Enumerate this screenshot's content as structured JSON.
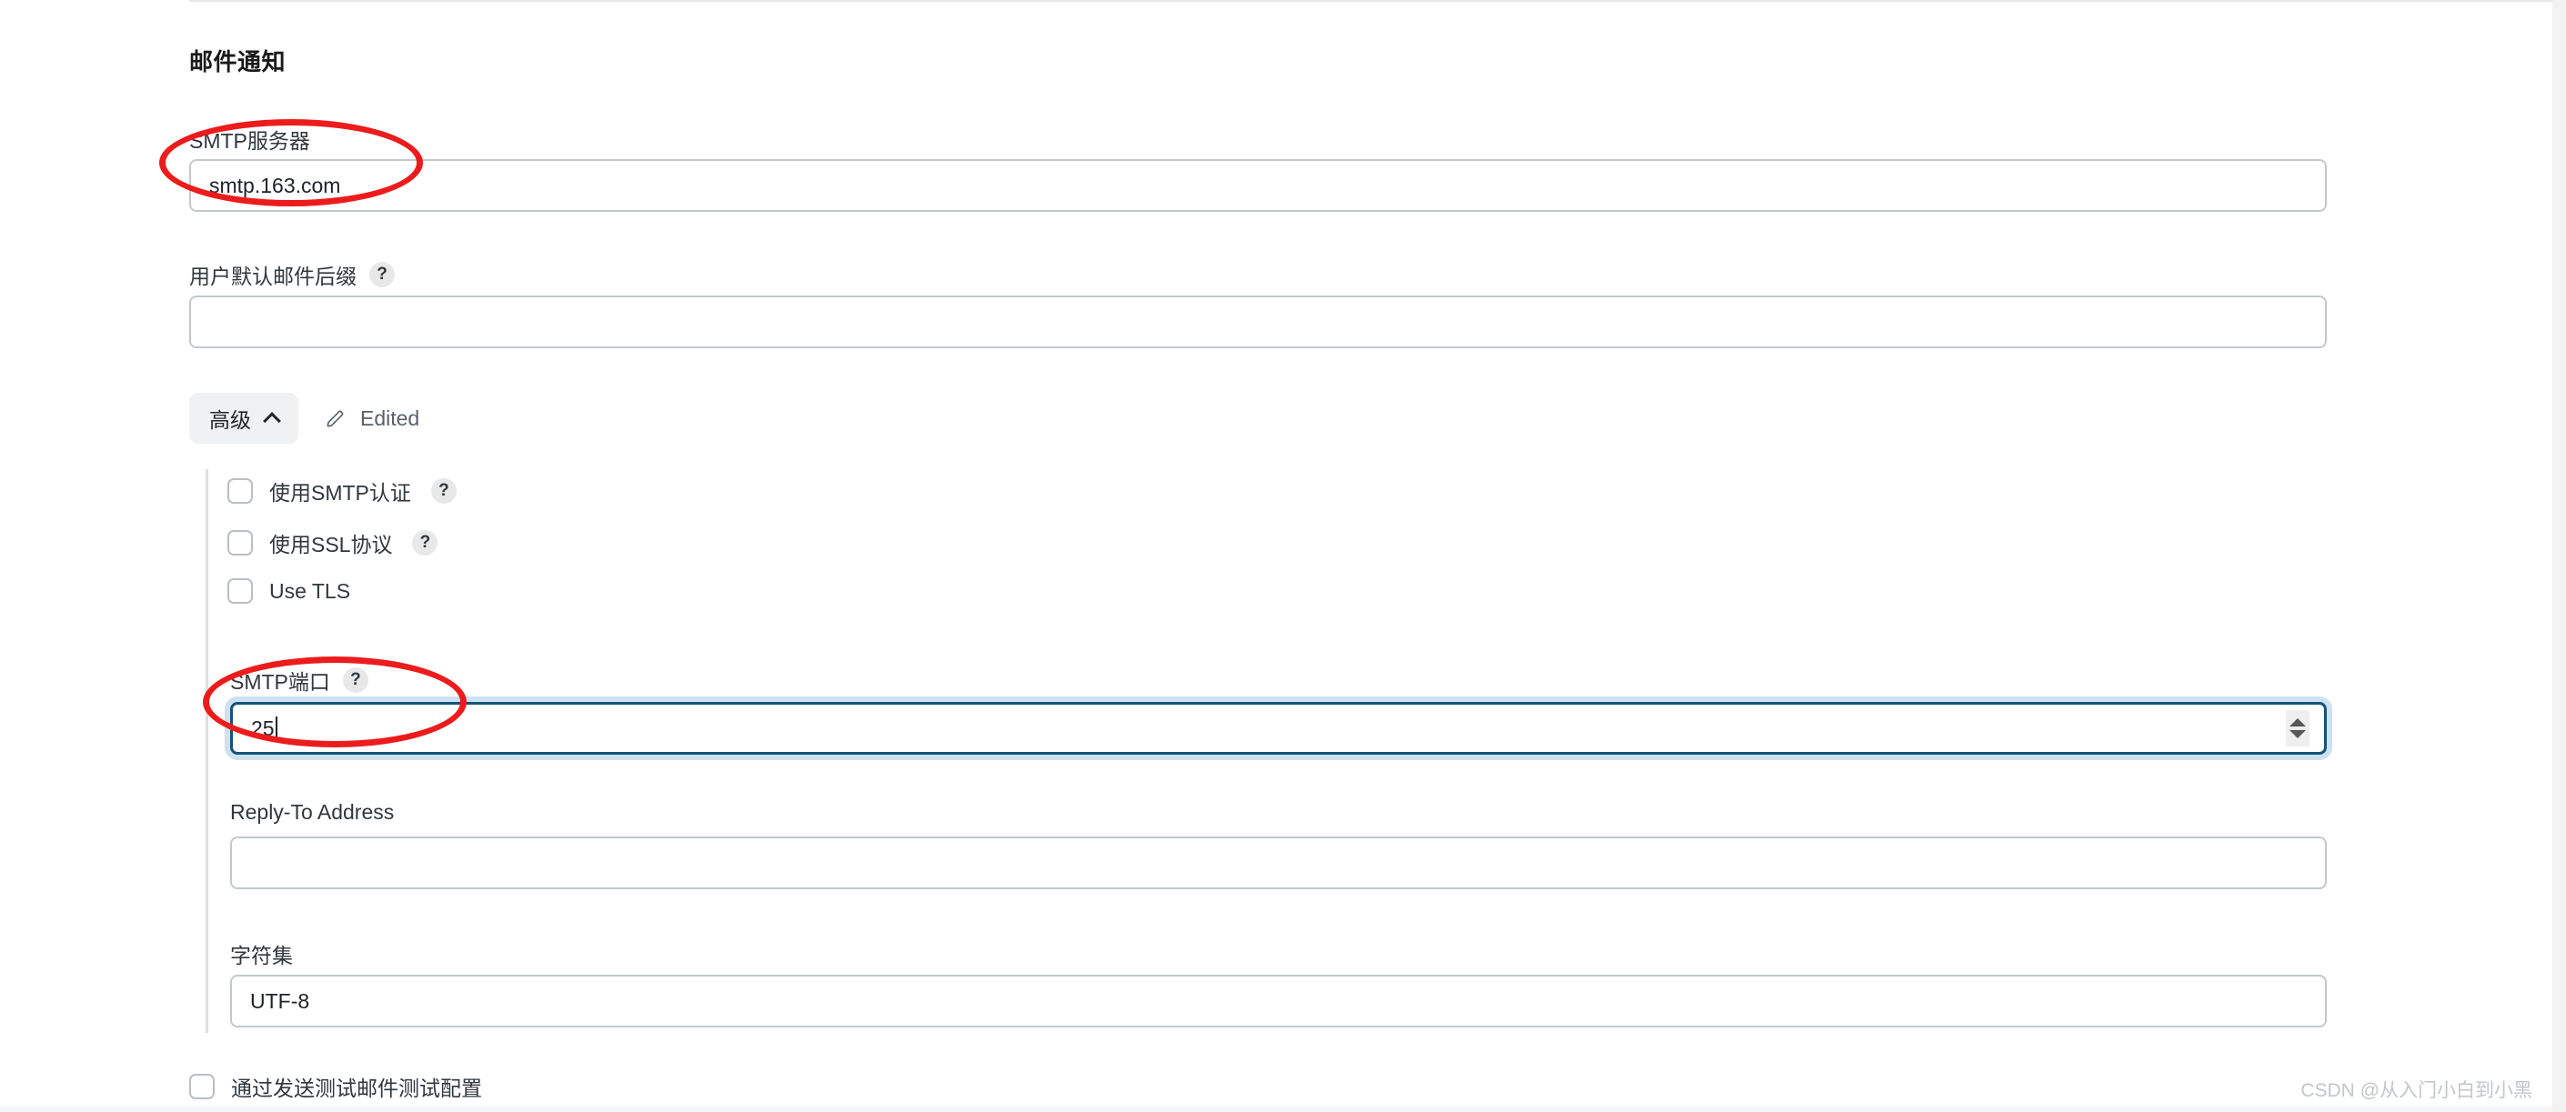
{
  "section": {
    "title": "邮件通知"
  },
  "fields": {
    "smtp_server": {
      "label": "SMTP服务器",
      "value": "smtp.163.com",
      "placeholder": ""
    },
    "default_suffix": {
      "label": "用户默认邮件后缀",
      "help": "?",
      "value": "",
      "placeholder": ""
    },
    "smtp_port": {
      "label": "SMTP端口",
      "help": "?",
      "value": "25",
      "placeholder": ""
    },
    "reply_to": {
      "label": "Reply-To Address",
      "value": "",
      "placeholder": ""
    },
    "charset": {
      "label": "字符集",
      "value": "UTF-8",
      "placeholder": ""
    }
  },
  "advanced": {
    "toggle_label": "高级",
    "toggle_icon": "chevron-up-icon",
    "status_icon": "pencil-icon",
    "status_label": "Edited"
  },
  "checkboxes": {
    "smtp_auth": {
      "label": "使用SMTP认证",
      "help": "?",
      "checked": false
    },
    "ssl": {
      "label": "使用SSL协议",
      "help": "?",
      "checked": false
    },
    "tls": {
      "label": "Use TLS",
      "checked": false
    },
    "test_config": {
      "label": "通过发送测试邮件测试配置",
      "checked": false
    }
  },
  "annotations": {
    "ellipse_smtp_server": "red-ellipse-annotation",
    "ellipse_smtp_port": "red-ellipse-annotation",
    "color": "#ec1c1c"
  },
  "watermark": {
    "text": "CSDN @从入门小白到小黑"
  },
  "colors": {
    "focus_border": "#14537a",
    "focus_ring": "#cde1f0",
    "input_border": "#c3c8cc",
    "annotation_red": "#ec1c1c"
  }
}
